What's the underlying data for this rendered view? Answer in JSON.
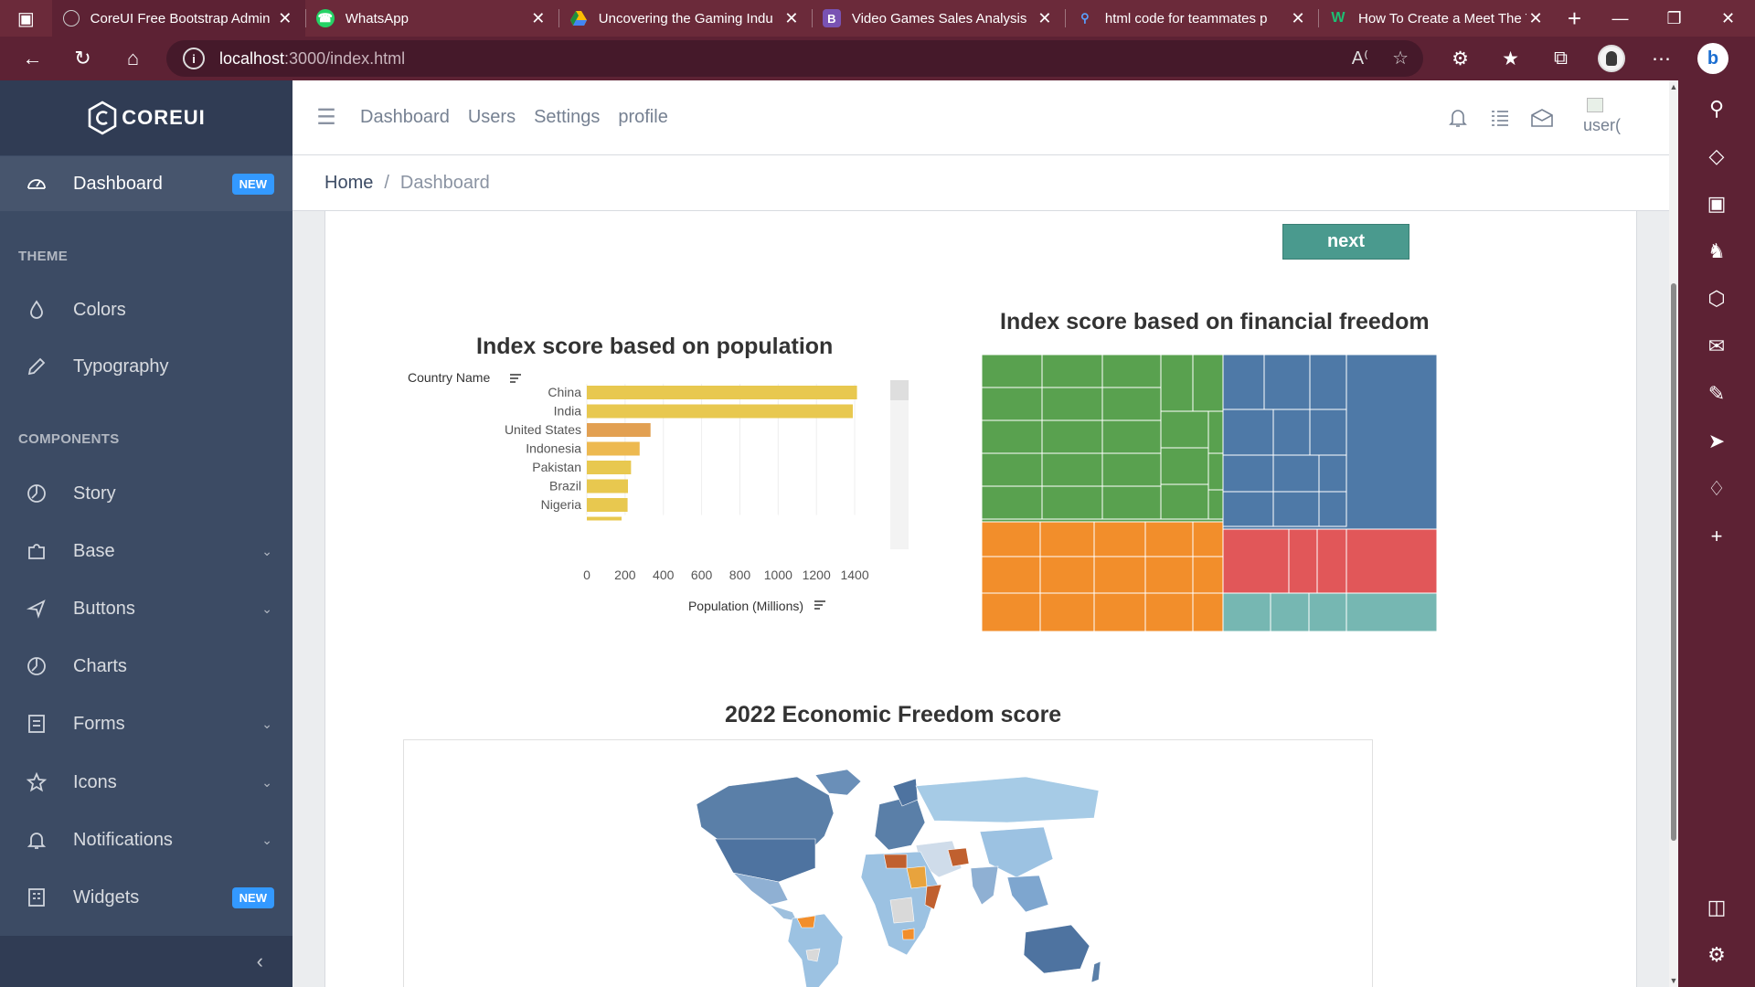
{
  "browser": {
    "tabs": [
      {
        "title": "CoreUI Free Bootstrap Admin",
        "icon": "coreui-favicon",
        "active": true
      },
      {
        "title": "WhatsApp",
        "icon": "whatsapp-favicon"
      },
      {
        "title": "Uncovering the Gaming Indu",
        "icon": "drive-favicon"
      },
      {
        "title": "Video Games Sales Analysis",
        "icon": "bootstrap-favicon"
      },
      {
        "title": "html code for teammates p",
        "icon": "search-favicon"
      },
      {
        "title": "How To Create a Meet The T",
        "icon": "wix-favicon"
      }
    ],
    "url_host": "localhost",
    "url_path": ":3000/index.html"
  },
  "sidebar": {
    "brand": "COREUI",
    "items": [
      {
        "label": "Dashboard",
        "badge": "NEW"
      },
      {
        "label": "Colors"
      },
      {
        "label": "Typography"
      },
      {
        "label": "Story"
      },
      {
        "label": "Base"
      },
      {
        "label": "Buttons"
      },
      {
        "label": "Charts"
      },
      {
        "label": "Forms"
      },
      {
        "label": "Icons"
      },
      {
        "label": "Notifications"
      },
      {
        "label": "Widgets",
        "badge": "NEW"
      }
    ],
    "section_theme": "THEME",
    "section_components": "COMPONENTS"
  },
  "header": {
    "nav": [
      "Dashboard",
      "Users",
      "Settings",
      "profile"
    ],
    "user_alt": "user("
  },
  "breadcrumb": {
    "home": "Home",
    "separator": "/",
    "current": "Dashboard"
  },
  "content": {
    "next_label": "next",
    "bar_title": "Index score based on population",
    "tree_title": "Index score based on financial freedom",
    "map_title": "2022 Economic Freedom score"
  },
  "chart_data": [
    {
      "type": "bar",
      "orientation": "horizontal",
      "title": "Index score based on population",
      "ylabel": "Country Name",
      "xlabel": "Population (Millions)",
      "categories": [
        "China",
        "India",
        "United States",
        "Indonesia",
        "Pakistan",
        "Brazil",
        "Nigeria"
      ],
      "values": [
        1412,
        1390,
        333,
        276,
        231,
        215,
        213
      ],
      "bar_colors": [
        "#e8c84f",
        "#e8c84f",
        "#e2a052",
        "#edb950",
        "#e8c84f",
        "#e8c84f",
        "#e8c84f"
      ],
      "xticks": [
        0,
        200,
        400,
        600,
        800,
        1000,
        1200,
        1400
      ],
      "xlim": [
        0,
        1500
      ]
    },
    {
      "type": "treemap",
      "title": "Index score based on financial freedom",
      "groups": [
        {
          "color": "#59a14f",
          "share": 0.44
        },
        {
          "color": "#f28e2b",
          "share": 0.29
        },
        {
          "color": "#4e79a7",
          "share": 0.17
        },
        {
          "color": "#e15759",
          "share": 0.06
        },
        {
          "color": "#76b7b2",
          "share": 0.04
        }
      ]
    }
  ],
  "colors": {
    "sidebar": "#3c4b64",
    "brand_bg": "#303c54",
    "badge": "#3399ff",
    "next_button": "#4a9a8e",
    "browser_frame": "#5d2234"
  }
}
